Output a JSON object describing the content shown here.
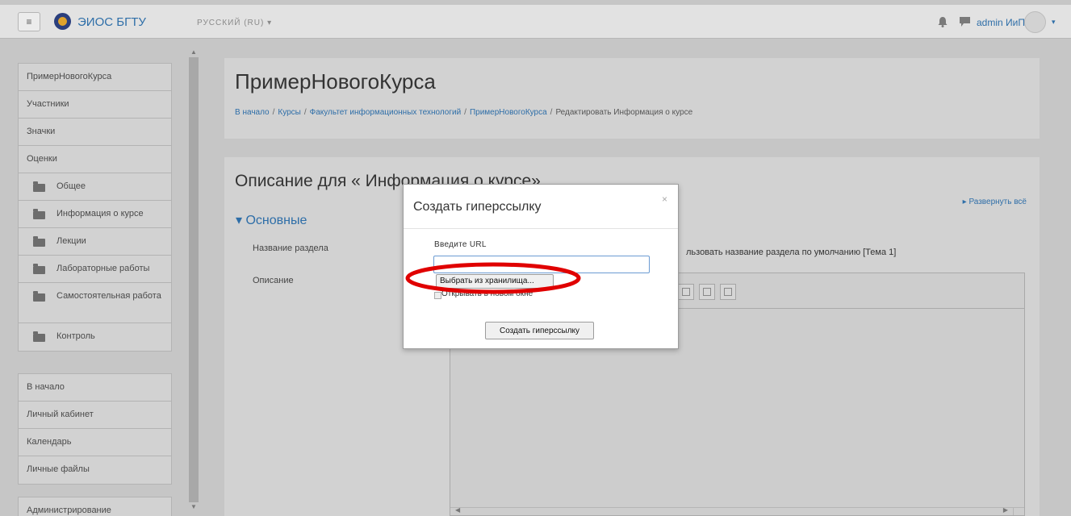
{
  "header": {
    "menu_icon": "hamburger-icon",
    "brand": "ЭИОС БГТУ",
    "language": "РУССКИЙ (RU) ▾",
    "notifications_icon": "bell-icon",
    "messages_icon": "chat-icon",
    "user_name": "admin ИиПО",
    "user_caret": "▾"
  },
  "sidebar": {
    "course_items": [
      {
        "label": "ПримерНовогоКурса"
      },
      {
        "label": "Участники"
      },
      {
        "label": "Значки"
      },
      {
        "label": "Оценки"
      },
      {
        "label": "Общее",
        "icon": "folder-icon"
      },
      {
        "label": "Информация о курсе",
        "icon": "folder-icon"
      },
      {
        "label": "Лекции",
        "icon": "folder-icon"
      },
      {
        "label": "Лабораторные работы",
        "icon": "folder-icon"
      },
      {
        "label": "Самостоятельная работа",
        "icon": "folder-icon"
      },
      {
        "label": "Контроль",
        "icon": "folder-icon"
      }
    ],
    "site_items": [
      {
        "label": "В начало"
      },
      {
        "label": "Личный кабинет"
      },
      {
        "label": "Календарь"
      },
      {
        "label": "Личные файлы"
      }
    ],
    "admin_items": [
      {
        "label": "Администрирование"
      }
    ]
  },
  "page": {
    "title": "ПримерНовогоКурса",
    "breadcrumb": [
      "В начало",
      "Курсы",
      "Факультет информационных технологий",
      "ПримерНовогоКурса",
      "Редактировать Информация о курсе"
    ],
    "breadcrumb_sep": "/"
  },
  "form": {
    "heading": "Описание для « Информация о курсе»",
    "expand_all": "▸ Развернуть всё",
    "section_toggle": "▾ Основные",
    "section_name_label": "Название раздела",
    "default_name_text": "льзовать название раздела по умолчанию [Тема 1]",
    "description_label": "Описание"
  },
  "dialog": {
    "title": "Создать гиперссылку",
    "close_label": "×",
    "url_label": "Введите URL",
    "url_value": "",
    "browse_label": "Выбрать из хранилища...",
    "new_window_label": "Открывать в новом окне",
    "create_label": "Создать гиперссылку"
  },
  "colors": {
    "accent": "#2e6ea8",
    "annotation": "#e00000",
    "backdrop": "#c6c6c6"
  }
}
